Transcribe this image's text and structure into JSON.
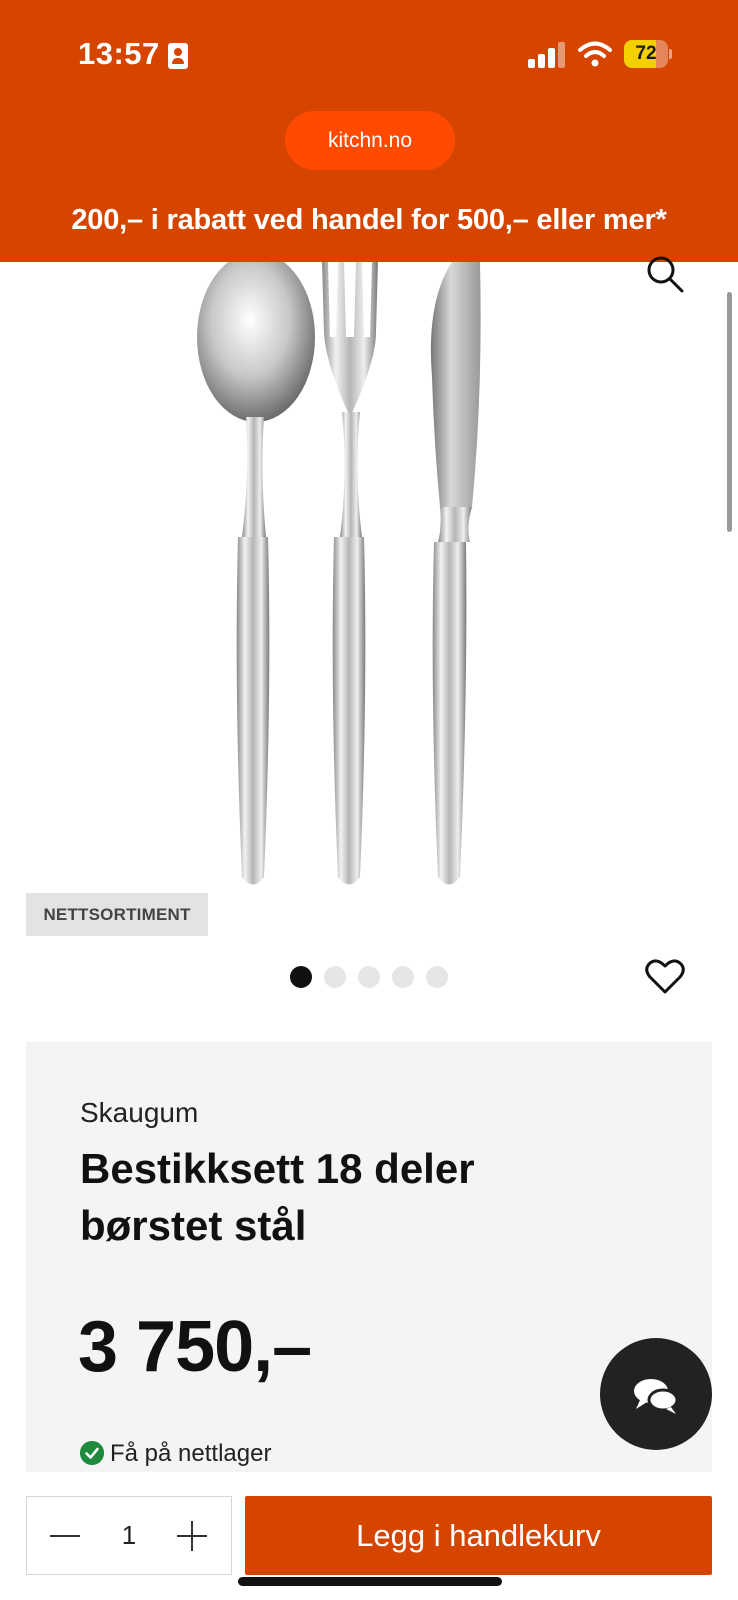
{
  "status_bar": {
    "time": "13:57",
    "battery_level": "72",
    "battery_fraction": 0.72
  },
  "browser": {
    "url": "kitchn.no"
  },
  "promo_banner": {
    "text": "200,– i rabatt ved handel for 500,– eller mer*"
  },
  "gallery": {
    "badge": "NETTSORTIMENT",
    "image_count": 5,
    "active_index": 0,
    "image_subject": "spoon, fork and knife in brushed steel"
  },
  "product": {
    "brand": "Skaugum",
    "title": "Bestikksett 18 deler børstet stål",
    "price": "3 750,–",
    "availability": "Få på nettlager"
  },
  "cart": {
    "quantity": "1",
    "add_to_cart_label": "Legg i handlekurv"
  },
  "icons": {
    "search": "search-icon",
    "favorite": "heart-icon",
    "chat": "chat-icon",
    "availability": "check-circle-icon",
    "decrease": "minus-icon",
    "increase": "plus-icon"
  },
  "colors": {
    "brand_orange": "#d64500",
    "url_pill": "#ff4a00",
    "stock_green": "#1e8a3c",
    "battery_yellow": "#f5d000"
  }
}
